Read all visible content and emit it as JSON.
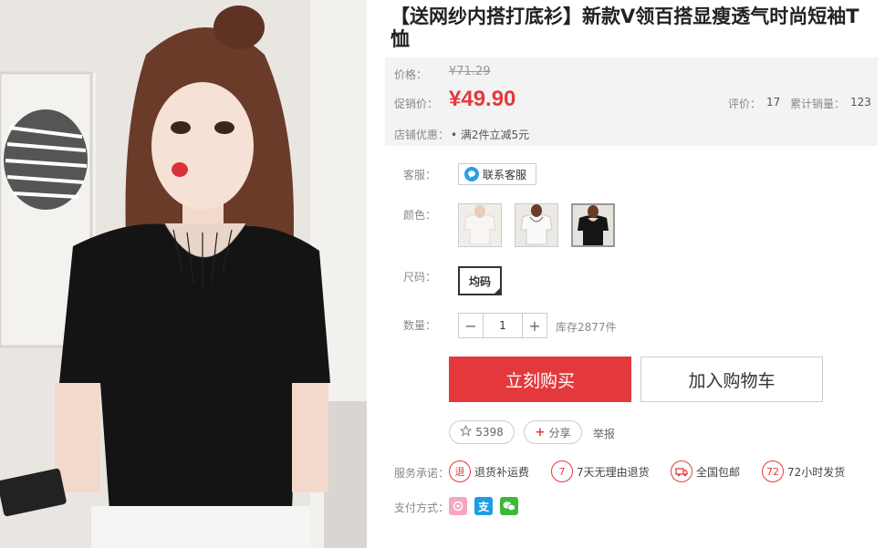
{
  "product": {
    "title": "【送网纱内搭打底衫】新款V领百搭显瘦透气时尚短袖T恤"
  },
  "price": {
    "original_label": "价格：",
    "original_value": "¥71.29",
    "promo_label": "促销价：",
    "promo_value": "¥49.90",
    "review_label": "评价：",
    "review_count": "17",
    "sales_label": "累计销量：",
    "sales_count": "123",
    "shop_label": "店铺优惠：",
    "shop_promo": "• 满2件立减5元"
  },
  "attributes": {
    "service_label": "客服：",
    "service_button": "联系客服",
    "color_label": "颜色：",
    "colors": [
      "white",
      "white-lace",
      "black"
    ],
    "size_label": "尺码：",
    "size_value": "均码",
    "quantity_label": "数量：",
    "quantity_value": "1",
    "quantity_minus": "−",
    "quantity_plus": "+",
    "stock": "库存2877件"
  },
  "actions": {
    "buy_now": "立刻购买",
    "add_to_cart": "加入购物车",
    "favorite_count": "5398",
    "share": "分享",
    "report": "举报"
  },
  "services": {
    "label": "服务承诺：",
    "items": [
      {
        "icon": "退",
        "text": "退货补运费"
      },
      {
        "icon": "7",
        "text": "7天无理由退货"
      },
      {
        "icon": "truck",
        "text": "全国包邮"
      },
      {
        "icon": "72",
        "text": "72小时发货"
      }
    ]
  },
  "payment": {
    "label": "支付方式：",
    "methods": [
      "huabei-icon",
      "alipay-icon",
      "wechat-pay-icon"
    ],
    "alipay_glyph": "支"
  },
  "colors": {
    "accent": "#e4393c",
    "price_bg": "#f3f3f3",
    "alipay": "#1c9ee0",
    "wechat": "#3db83b",
    "huabei": "#f7a6c0"
  }
}
